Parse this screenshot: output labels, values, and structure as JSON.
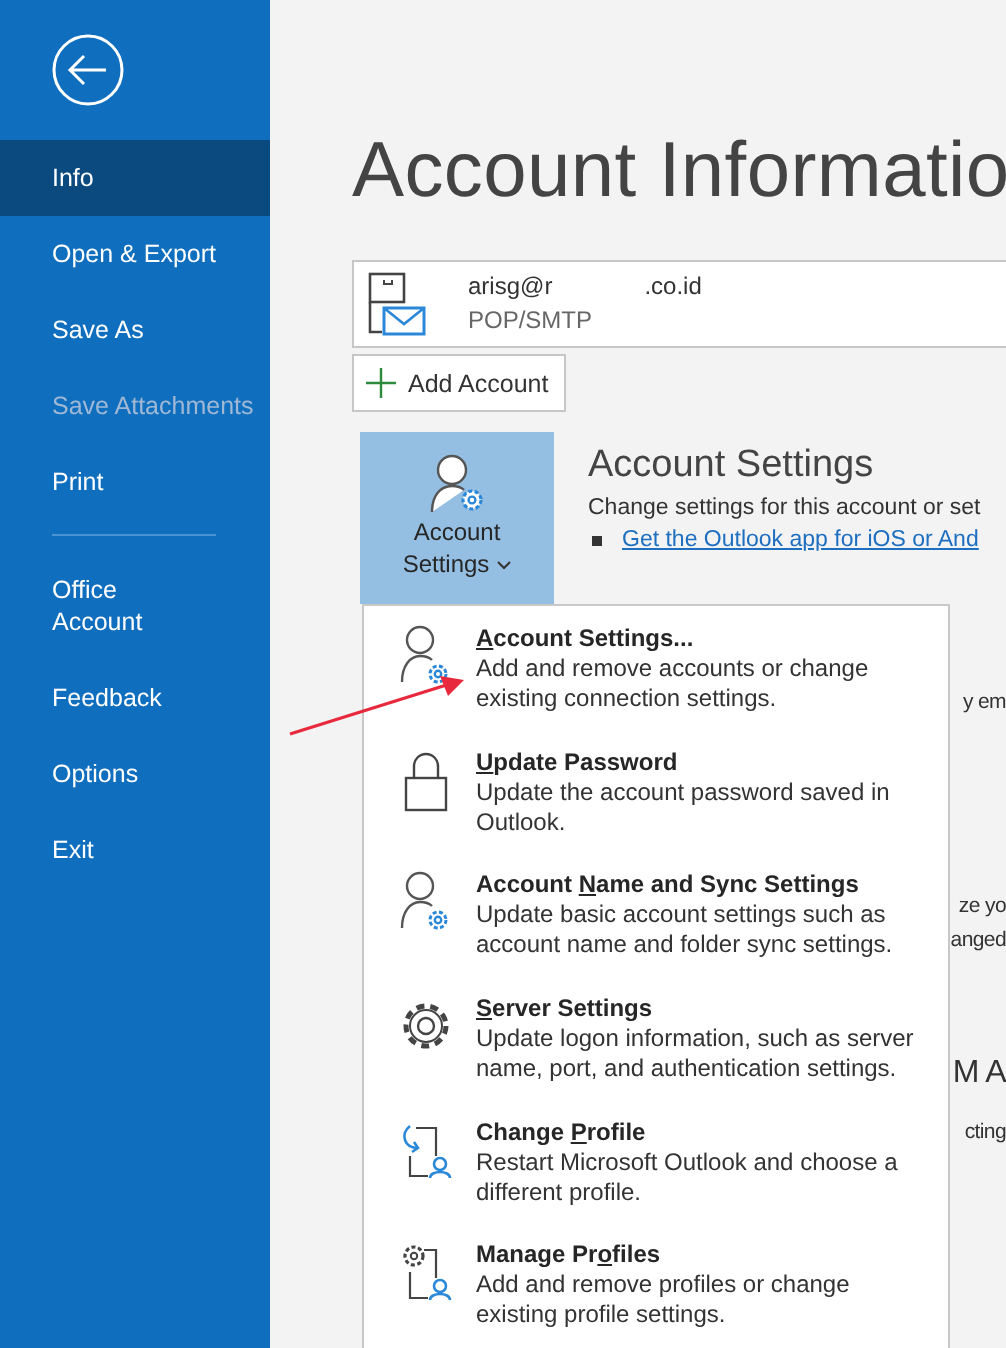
{
  "sidebar": {
    "items": [
      {
        "label": "Info",
        "selected": true,
        "disabled": false
      },
      {
        "label": "Open & Export",
        "selected": false,
        "disabled": false
      },
      {
        "label": "Save As",
        "selected": false,
        "disabled": false
      },
      {
        "label": "Save Attachments",
        "selected": false,
        "disabled": true
      },
      {
        "label": "Print",
        "selected": false,
        "disabled": false
      },
      {
        "kind": "divider"
      },
      {
        "label": "Office\nAccount",
        "selected": false,
        "disabled": false
      },
      {
        "label": "Feedback",
        "selected": false,
        "disabled": false
      },
      {
        "label": "Options",
        "selected": false,
        "disabled": false
      },
      {
        "label": "Exit",
        "selected": false,
        "disabled": false
      }
    ]
  },
  "main": {
    "title": "Account Informatio",
    "account": {
      "email_start": "arisg@r",
      "email_end": ".co.id",
      "type": "POP/SMTP"
    },
    "add_account": "Add Account",
    "account_settings_button": {
      "label": "Account\nSettings"
    },
    "section": {
      "heading": "Account Settings",
      "description": "Change settings for this account or set",
      "link": "Get the Outlook app for iOS or And"
    },
    "obscured_fragments": [
      {
        "kind": "text",
        "text": "y em"
      },
      {
        "kind": "text",
        "text": "ze yo"
      },
      {
        "kind": "text",
        "text": "anged"
      },
      {
        "kind": "heading",
        "text": "M A"
      },
      {
        "kind": "text",
        "text": "cting"
      }
    ]
  },
  "dropdown": {
    "items": [
      {
        "mnemonic": "A",
        "title_after": "ccount Settings...",
        "description": "Add and remove accounts or change existing connection settings."
      },
      {
        "mnemonic": "U",
        "title_after": "pdate Password",
        "description": "Update the account password saved in Outlook."
      },
      {
        "title_before": "Account ",
        "mnemonic": "N",
        "title_after": "ame and Sync Settings",
        "description": "Update basic account settings such as account name and folder sync settings."
      },
      {
        "mnemonic": "S",
        "title_after": "erver Settings",
        "description": "Update logon information, such as server name, port, and authentication settings."
      },
      {
        "title_before": "Change ",
        "mnemonic": "P",
        "title_after": "rofile",
        "description": "Restart Microsoft Outlook and choose a different profile."
      },
      {
        "title_before": "Manage Pr",
        "mnemonic": "o",
        "title_after": "files",
        "description": "Add and remove profiles or change existing profile settings."
      }
    ]
  }
}
